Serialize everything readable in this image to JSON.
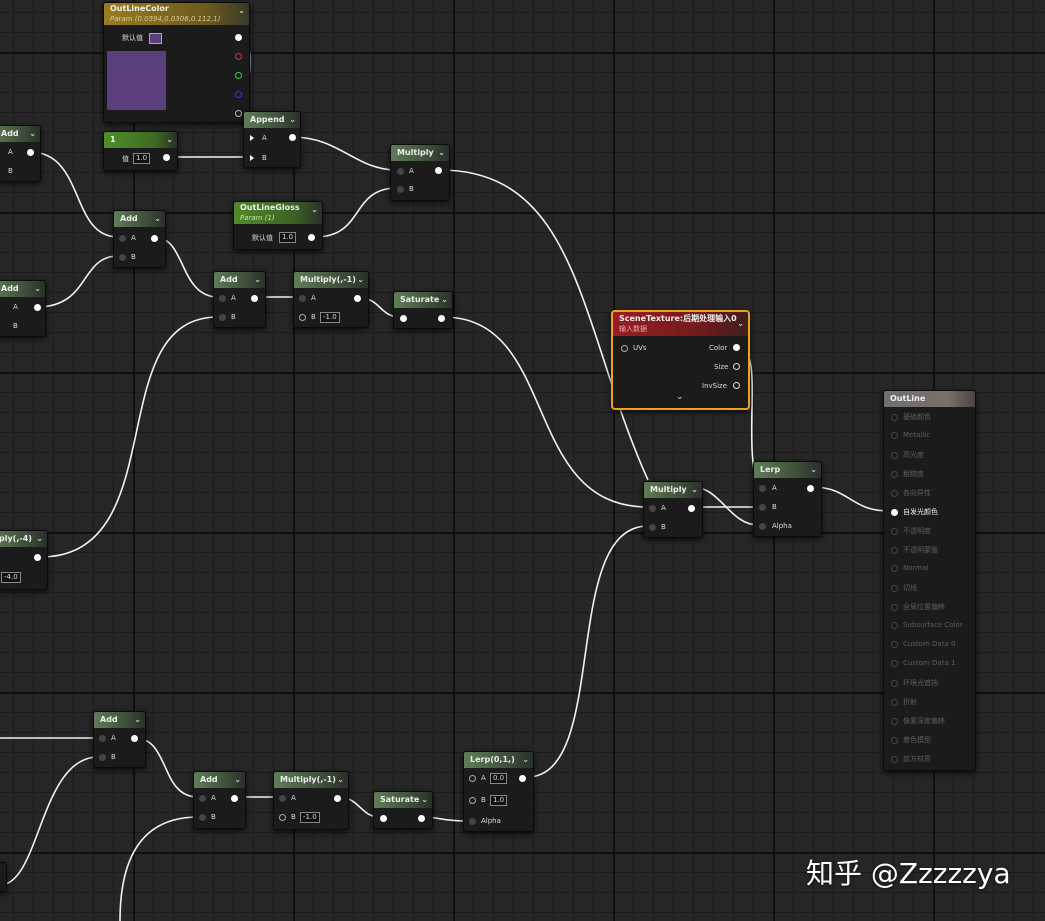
{
  "nodes": {
    "outline_color": {
      "title": "OutLineColor",
      "subtitle": "Param (0.0594,0.0306,0.112,1)",
      "default_label": "默认值"
    },
    "const_1": {
      "title": "1",
      "value_label": "值",
      "value": "1.0"
    },
    "append": {
      "title": "Append",
      "pin_a": "A",
      "pin_b": "B"
    },
    "multiply_top": {
      "title": "Multiply",
      "pin_a": "A",
      "pin_b": "B"
    },
    "outline_gloss": {
      "title": "OutLineGloss",
      "subtitle": "Param (1)",
      "default_label": "默认值",
      "value": "1.0"
    },
    "add_left1": {
      "title": "Add",
      "pin_a": "A",
      "pin_b": "B"
    },
    "add_mid1": {
      "title": "Add",
      "pin_a": "A",
      "pin_b": "B"
    },
    "add_left2": {
      "title": "Add",
      "pin_a": "A",
      "pin_b": "B"
    },
    "add_mid2": {
      "title": "Add",
      "pin_a": "A",
      "pin_b": "B"
    },
    "multiply_neg1_top": {
      "title": "Multiply(,-1)",
      "pin_a": "A",
      "pin_b": "B",
      "b_value": "-1.0"
    },
    "saturate_top": {
      "title": "Saturate"
    },
    "multiply_neg4": {
      "title": "ply(,-4)",
      "value": "-4.0"
    },
    "scene_texture": {
      "title": "SceneTexture:后期处理输入0",
      "subtitle": "输入数据",
      "pin_uvs": "UVs",
      "pin_color": "Color",
      "pin_size": "Size",
      "pin_invsize": "InvSize"
    },
    "multiply_mid": {
      "title": "Multiply",
      "pin_a": "A",
      "pin_b": "B"
    },
    "lerp": {
      "title": "Lerp",
      "pin_a": "A",
      "pin_b": "B",
      "pin_alpha": "Alpha"
    },
    "add_bottom1": {
      "title": "Add",
      "pin_a": "A",
      "pin_b": "B"
    },
    "add_bottom2": {
      "title": "Add",
      "pin_a": "A",
      "pin_b": "B"
    },
    "multiply_neg1_bottom": {
      "title": "Multiply(,-1)",
      "pin_a": "A",
      "pin_b": "B",
      "b_value": "-1.0"
    },
    "saturate_bottom": {
      "title": "Saturate"
    },
    "lerp01": {
      "title": "Lerp(0,1,)",
      "pin_a": "A",
      "a_value": "0.0",
      "pin_b": "B",
      "b_value": "1.0",
      "pin_alpha": "Alpha"
    }
  },
  "outline_material": {
    "title": "OutLine",
    "pins": [
      "基础颜色",
      "Metallic",
      "高光度",
      "粗糙度",
      "各向异性",
      "自发光颜色",
      "不透明度",
      "不透明蒙版",
      "Normal",
      "切线",
      "全局位置偏移",
      "Subsurface Color",
      "Custom Data 0",
      "Custom Data 1",
      "环境光遮挡",
      "折射",
      "像素深度偏移",
      "着色模型",
      "前方材质"
    ],
    "active_pin": "自发光颜色"
  },
  "colors": {
    "outline_color_swatch": "#5a3f7c",
    "scene_texture_header": "#8a1d1d",
    "selection_border": "#f0a020"
  },
  "watermark": "知乎 @Zzzzzya"
}
